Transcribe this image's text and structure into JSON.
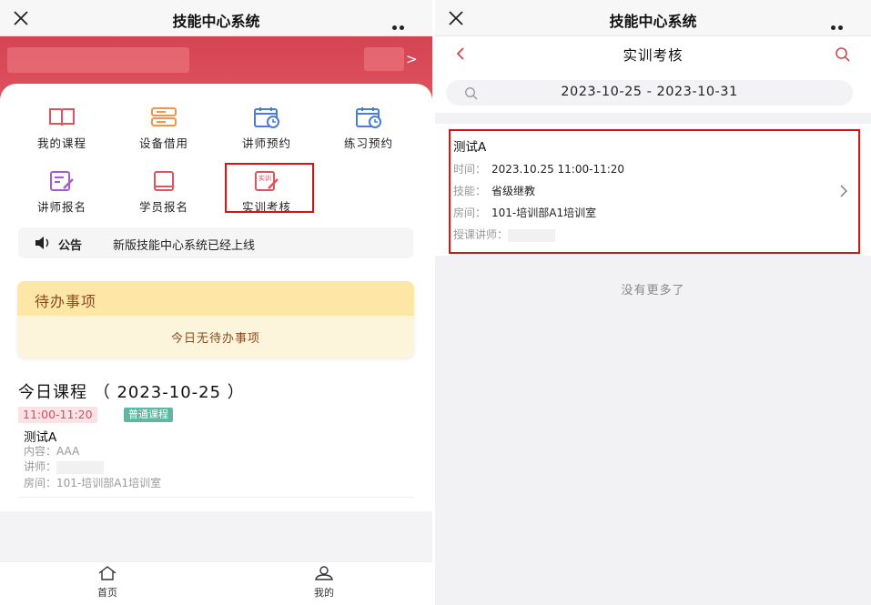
{
  "left": {
    "window_title": "技能中心系统",
    "grid": [
      {
        "label": "我的课程",
        "icon": "book-icon",
        "color": "#e0525c"
      },
      {
        "label": "设备借用",
        "icon": "device-list-icon",
        "color": "#f0954a"
      },
      {
        "label": "讲师预约",
        "icon": "calendar-clock-icon",
        "color": "#4a7bd8"
      },
      {
        "label": "练习预约",
        "icon": "calendar-clock-icon",
        "color": "#4a7bd8"
      },
      {
        "label": "讲师报名",
        "icon": "edit-form-icon",
        "color": "#a45bd8"
      },
      {
        "label": "学员报名",
        "icon": "book-closed-icon",
        "color": "#e0525c"
      },
      {
        "label": "实训考核",
        "icon": "training-assessment-icon",
        "color": "#e0525c",
        "icon_text": "实训"
      }
    ],
    "notice": {
      "label": "公告",
      "text": "新版技能中心系统已经上线"
    },
    "todo": {
      "title": "待办事项",
      "empty_text": "今日无待办事项"
    },
    "today": {
      "title": "今日课程 （ 2023-10-25 ）",
      "time": "11:00-11:20",
      "type": "普通课程",
      "name": "测试A",
      "content_label": "内容：",
      "content_value": "AAA",
      "teacher_label": "讲师：",
      "room_label": "房间：",
      "room_value": "101-培训部A1培训室"
    },
    "tabs": [
      {
        "label": "首页",
        "icon": "home-icon"
      },
      {
        "label": "我的",
        "icon": "user-icon"
      }
    ]
  },
  "right": {
    "window_title": "技能中心系统",
    "page_title": "实训考核",
    "date_range": "2023-10-25 - 2023-10-31",
    "record": {
      "name": "测试A",
      "time_label": "时间：",
      "time_value": "2023.10.25 11:00-11:20",
      "skill_label": "技能：",
      "skill_value": "省级继教",
      "room_label": "房间：",
      "room_value": "101-培训部A1培训室",
      "teacher_label": "授课讲师："
    },
    "no_more": "没有更多了"
  },
  "colors": {
    "accent": "#d44452",
    "highlight": "#e01010",
    "todo_header": "#fde7a7",
    "todo_text": "#8a4a1e"
  }
}
